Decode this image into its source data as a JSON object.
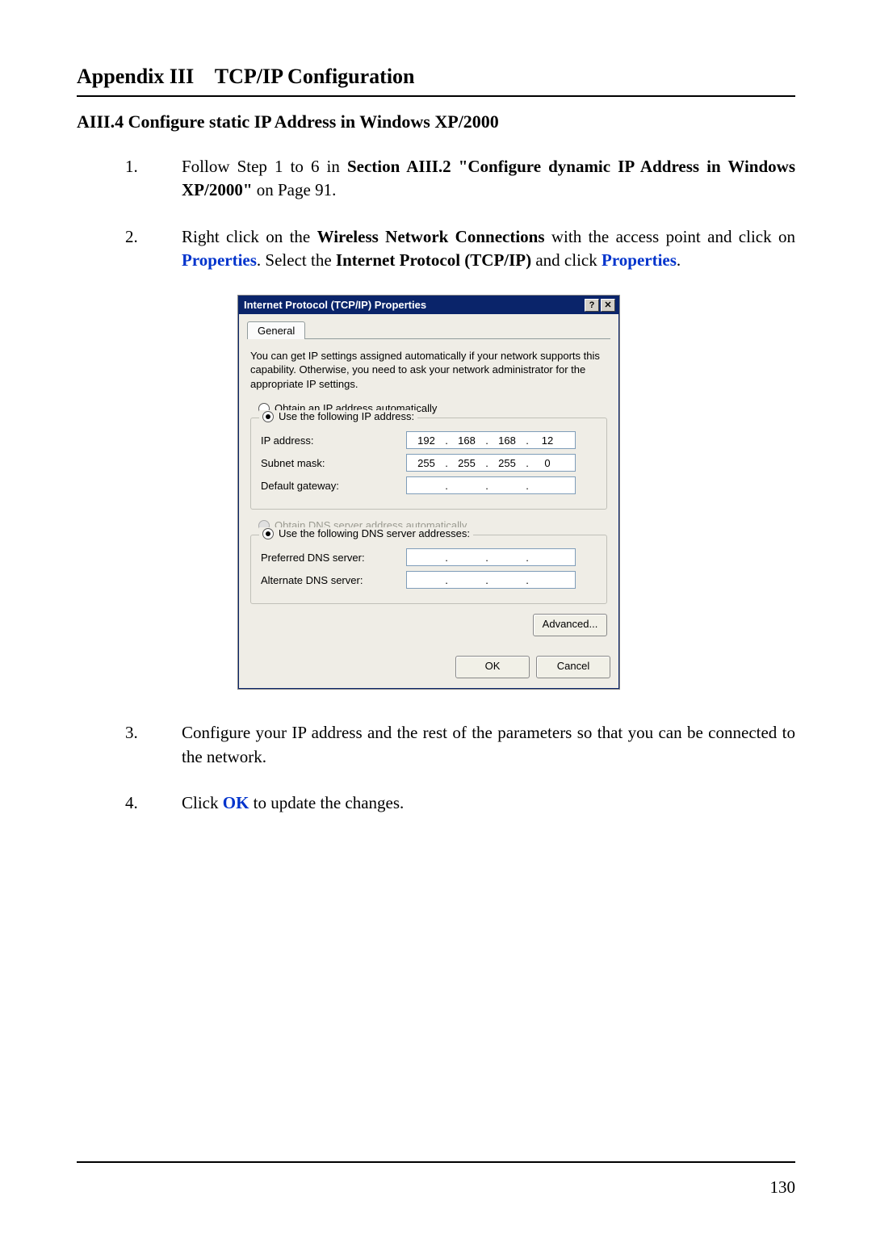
{
  "header": {
    "appendix_title": "Appendix III",
    "appendix_subject": "TCP/IP Configuration"
  },
  "section": {
    "title": "AIII.4 Configure static IP Address in Windows XP/2000"
  },
  "steps": [
    {
      "num": "1.",
      "prefix": "Follow Step 1 to 6 in ",
      "bold1": "Section AIII.2 \"Configure dynamic IP Address in Windows XP/2000\"",
      "suffix1": " on Page 91."
    },
    {
      "num": "2.",
      "prefix": "Right click on the ",
      "bold1": "Wireless Network Connections",
      "mid1": " with the access point and click on ",
      "blue1": "Properties",
      "mid2": ". Select the ",
      "bold2": "Internet Protocol (TCP/IP)",
      "mid3": " and click ",
      "blue2": "Properties",
      "suffix1": "."
    },
    {
      "num": "3.",
      "prefix": "Configure your IP address and the rest of the parameters so that you can be connected to the network."
    },
    {
      "num": "4.",
      "prefix": "Click ",
      "blue1": "OK",
      "suffix1": " to update the changes."
    }
  ],
  "dialog": {
    "title": "Internet Protocol (TCP/IP) Properties",
    "help_glyph": "?",
    "close_glyph": "✕",
    "tab_general": "General",
    "explain": "You can get IP settings assigned automatically if your network supports this capability. Otherwise, you need to ask your network administrator for the appropriate IP settings.",
    "radio_obtain_ip": "Obtain an IP address automatically",
    "radio_use_ip": "Use the following IP address:",
    "label_ip": "IP address:",
    "label_mask": "Subnet mask:",
    "label_gateway": "Default gateway:",
    "ip_octets": [
      "192",
      "168",
      "168",
      "12"
    ],
    "mask_octets": [
      "255",
      "255",
      "255",
      "0"
    ],
    "gateway_octets": [
      "",
      "",
      "",
      ""
    ],
    "radio_obtain_dns": "Obtain DNS server address automatically",
    "radio_use_dns": "Use the following DNS server addresses:",
    "label_pref_dns": "Preferred DNS server:",
    "label_alt_dns": "Alternate DNS server:",
    "pref_dns_octets": [
      "",
      "",
      "",
      ""
    ],
    "alt_dns_octets": [
      "",
      "",
      "",
      ""
    ],
    "btn_advanced": "Advanced...",
    "btn_ok": "OK",
    "btn_cancel": "Cancel"
  },
  "footer": {
    "page_num": "130"
  }
}
